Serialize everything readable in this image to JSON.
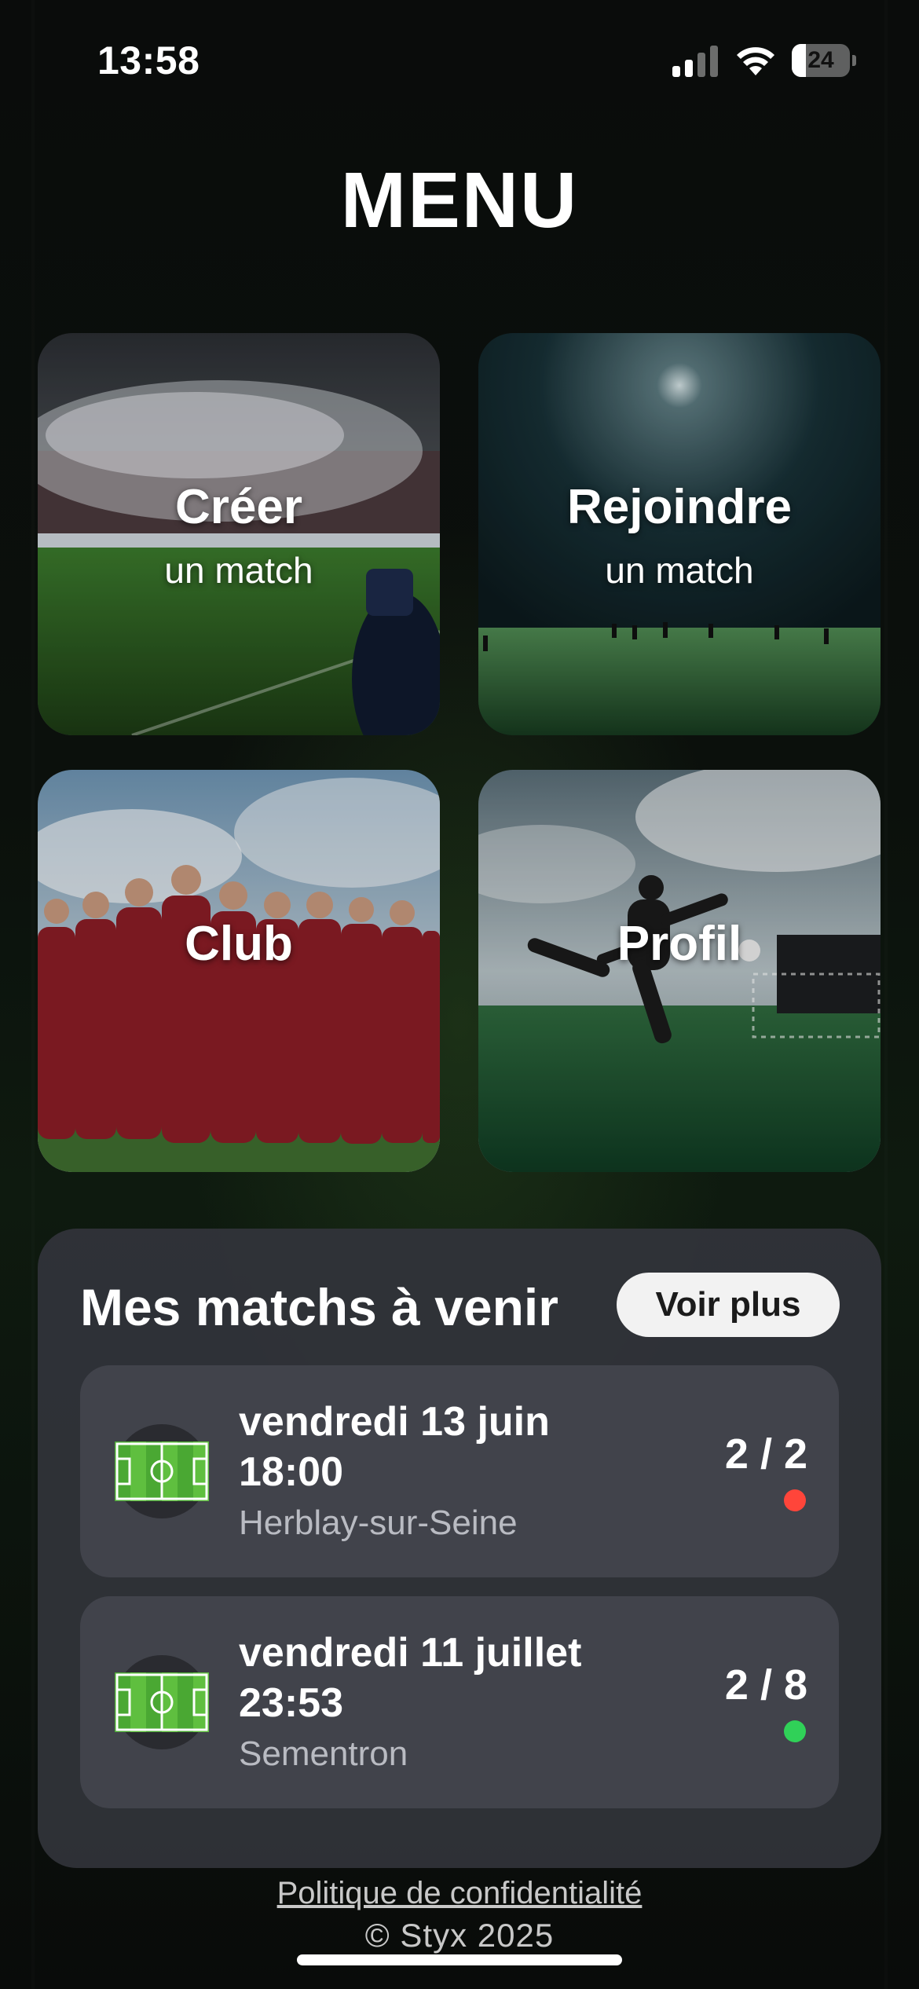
{
  "status_bar": {
    "time": "13:58",
    "battery_level": "24",
    "icons": [
      "signal-icon",
      "wifi-icon",
      "battery-icon"
    ]
  },
  "page": {
    "title": "MENU"
  },
  "tiles": [
    {
      "title": "Créer",
      "subtitle": "un match"
    },
    {
      "title": "Rejoindre",
      "subtitle": "un match"
    },
    {
      "title": "Club",
      "subtitle": ""
    },
    {
      "title": "Profil",
      "subtitle": ""
    }
  ],
  "upcoming": {
    "title": "Mes matchs à venir",
    "more_label": "Voir plus",
    "matches": [
      {
        "date": "vendredi 13 juin",
        "time": "18:00",
        "place": "Herblay-sur-Seine",
        "count": "2 / 2",
        "status_color": "#ff453a",
        "icon": "soccer-field-icon"
      },
      {
        "date": "vendredi 11 juillet",
        "time": "23:53",
        "place": "Sementron",
        "count": "2 / 8",
        "status_color": "#30d158",
        "icon": "soccer-field-icon"
      }
    ]
  },
  "footer": {
    "privacy_link": "Politique de confidentialité",
    "copyright": "© Styx 2025"
  },
  "colors": {
    "panel": "#323439",
    "card": "#41434b",
    "full": "#ff453a",
    "open": "#30d158"
  }
}
